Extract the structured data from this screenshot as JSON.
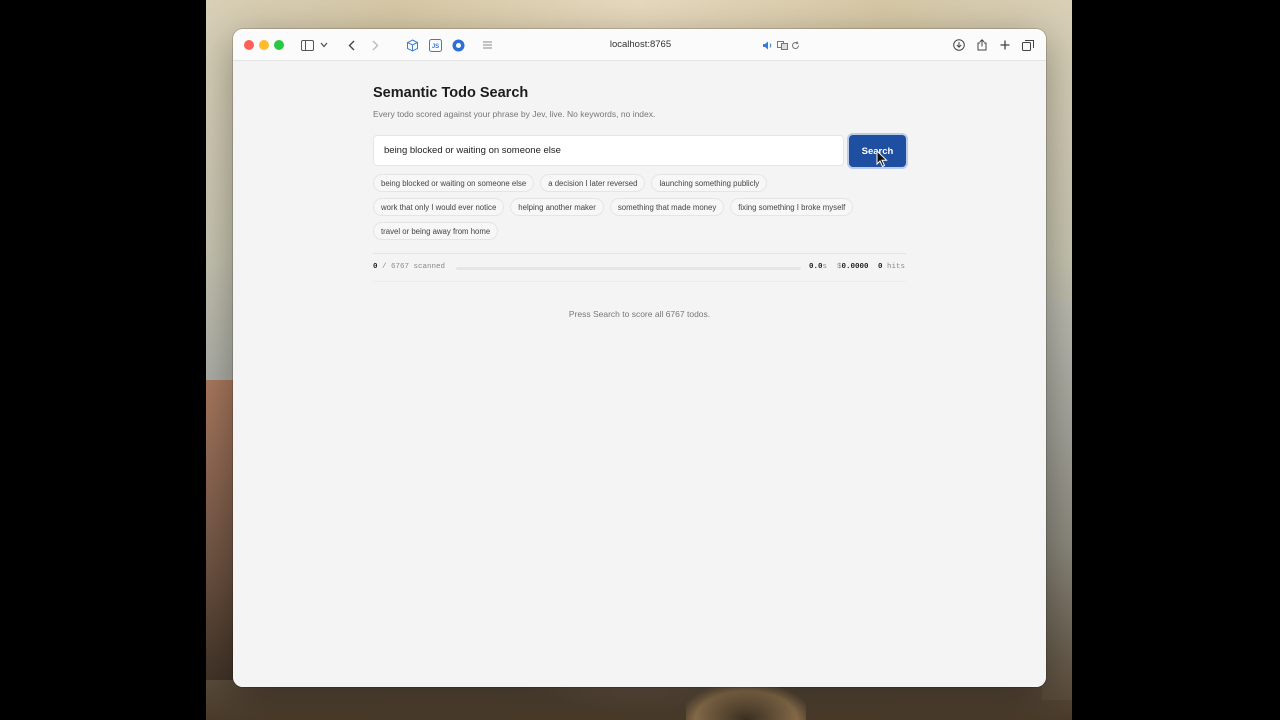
{
  "browser": {
    "url": "localhost:8765"
  },
  "page": {
    "title": "Semantic Todo Search",
    "subtitle": "Every todo scored against your phrase by Jev, live. No keywords, no index."
  },
  "search": {
    "value": "being blocked or waiting on someone else",
    "button_label": "Search"
  },
  "suggestions": [
    [
      "being blocked or waiting on someone else",
      "a decision I later reversed",
      "launching something publicly"
    ],
    [
      "work that only I would ever notice",
      "helping another maker",
      "something that made money",
      "fixing something I broke myself"
    ],
    [
      "travel or being away from home"
    ]
  ],
  "progress": {
    "scanned": "0",
    "total_label": "/ 6767 scanned",
    "fraction": 0,
    "time_value": "0.0",
    "time_unit": "s",
    "cost_prefix": "$",
    "cost_value": "0.0000",
    "hits_value": "0",
    "hits_label": "hits"
  },
  "empty_state": "Press Search to score all 6767 todos.",
  "colors": {
    "accent": "#1f4fa0"
  }
}
